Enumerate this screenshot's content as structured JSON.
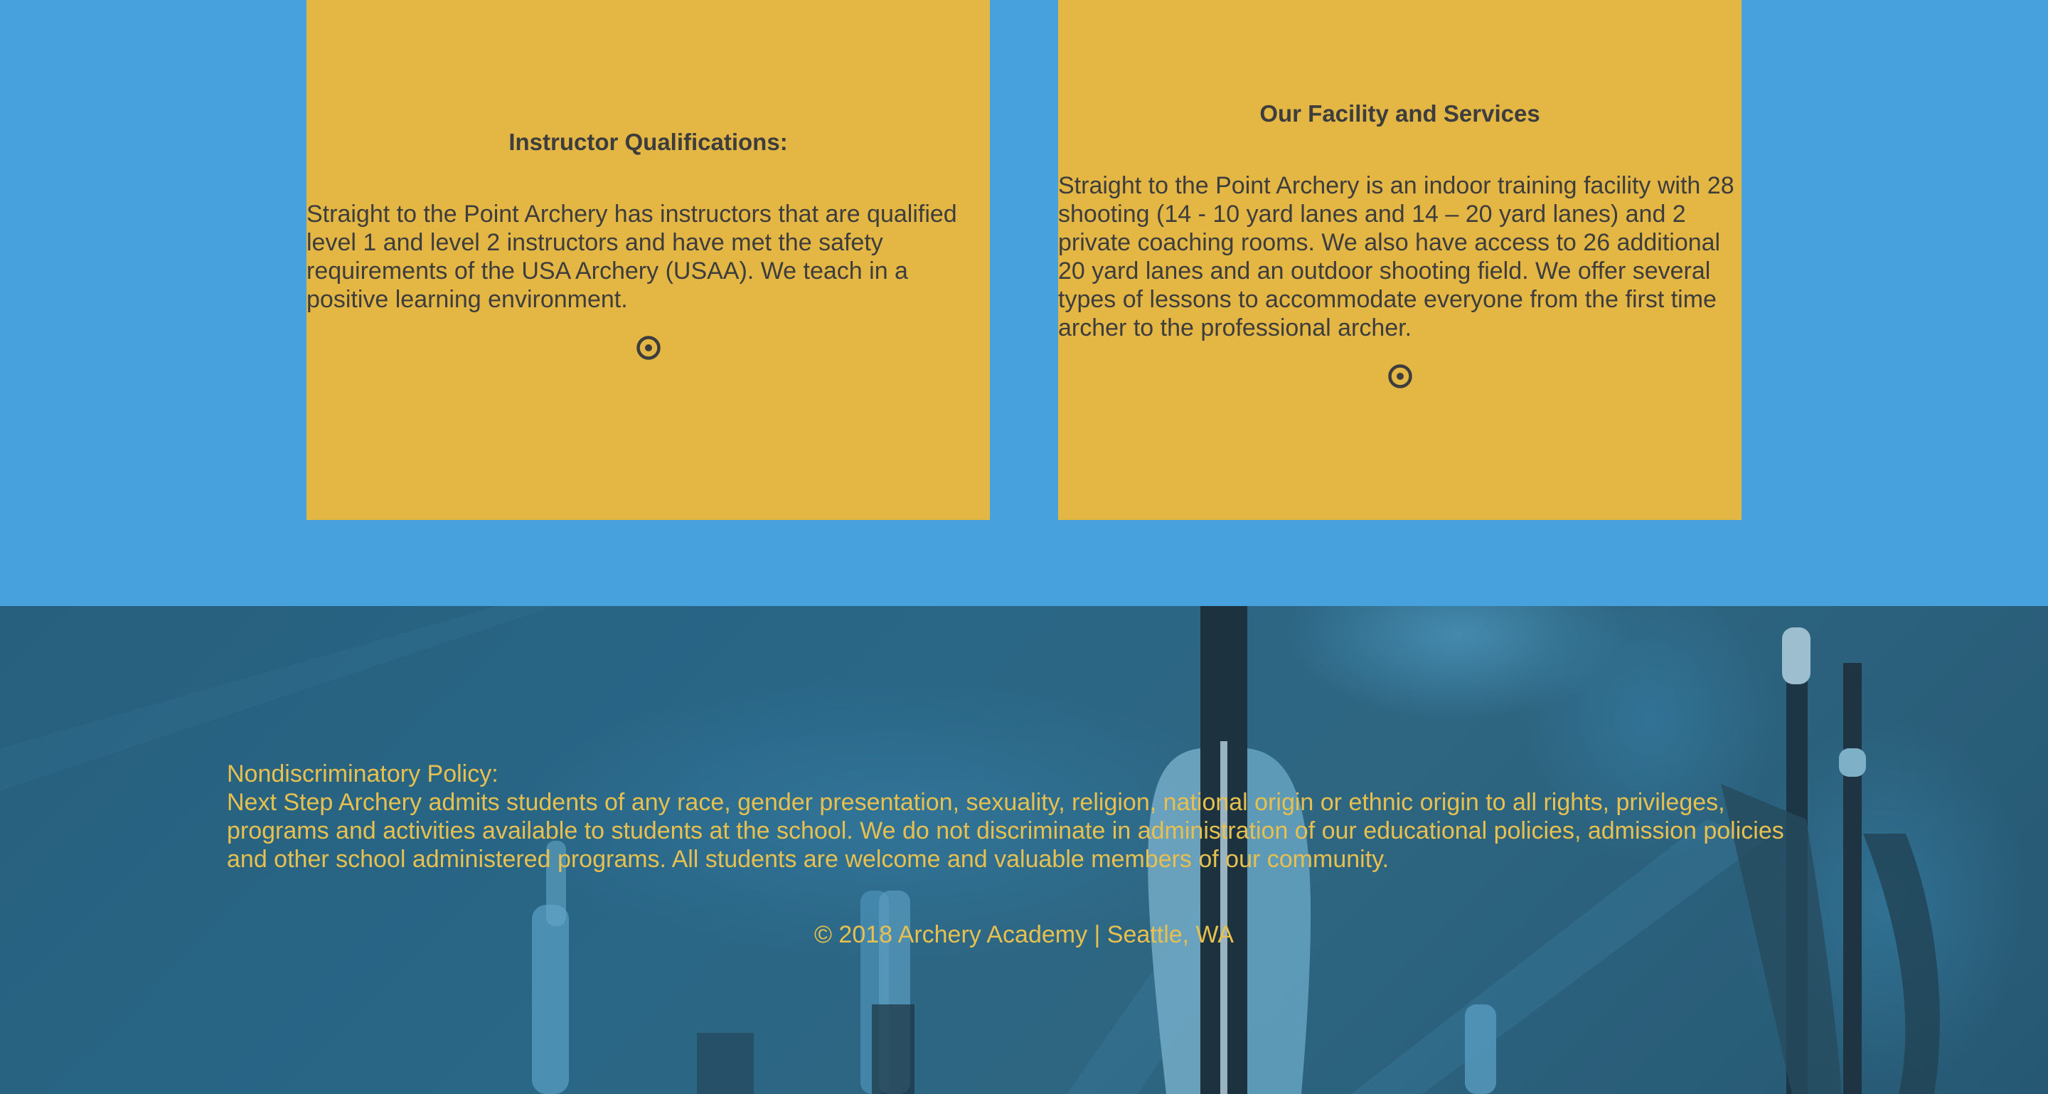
{
  "cards": [
    {
      "title": "Instructor Qualifications:",
      "body": "Straight to the Point Archery has instructors that are qualified level 1 and level 2 instructors and have met the safety requirements of the USA Archery (USAA). We teach in a positive learning environment.",
      "icon": "target-icon"
    },
    {
      "title": "Our Facility and Services",
      "body": "Straight to the Point Archery is an indoor training facility with 28 shooting (14 - 10 yard lanes and 14 – 20 yard lanes) and 2 private coaching rooms. We also have access to 26 additional 20 yard lanes and an outdoor shooting field. We offer several types of lessons to accommodate everyone from the first time archer to the professional archer.",
      "icon": "target-icon"
    }
  ],
  "footer": {
    "policy_title": "Nondiscriminatory Policy:",
    "policy_text": "Next Step Archery admits students of any race, gender presentation, sexuality, religion, national origin or ethnic origin to all rights, privileges, programs and activities available to students at the school. We do not discriminate in administration of our educational policies, admission policies and other school administered programs. All students are welcome and valuable members of our community.",
    "copyright": "© 2018 Archery Academy | Seattle, WA",
    "background_image": "arrows-photo"
  },
  "colors": {
    "top_background": "#47a1dc",
    "card_background": "#e4b745",
    "card_text": "#3d3d3d",
    "footer_text": "#e8c04f"
  }
}
